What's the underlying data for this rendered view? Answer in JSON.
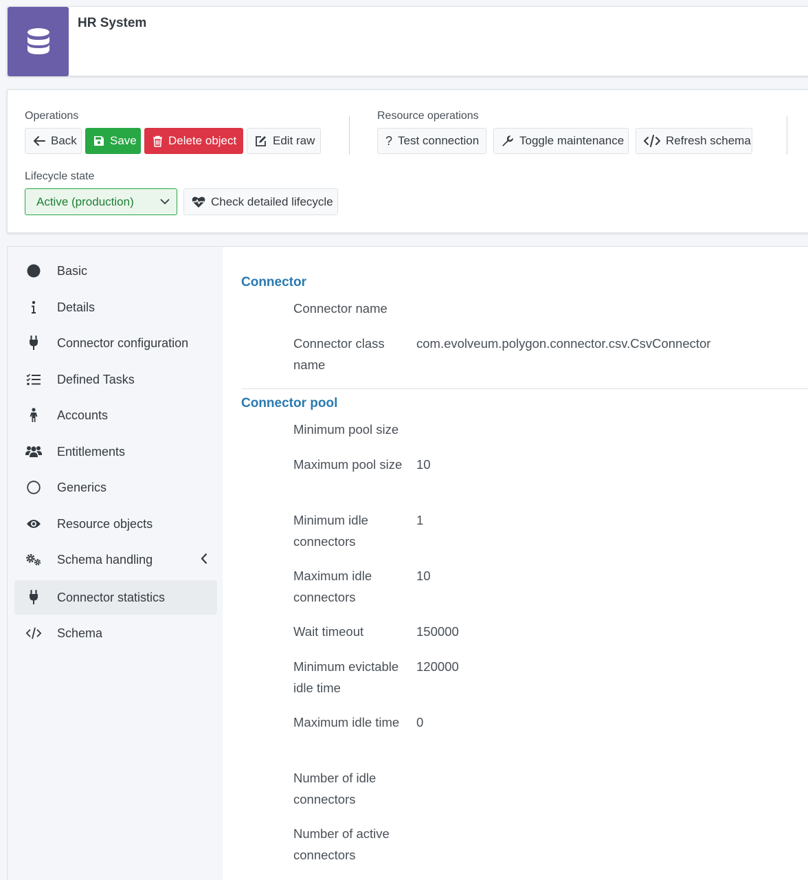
{
  "header": {
    "title": "HR System",
    "icon": "database-icon",
    "accent": "#6a5ea8"
  },
  "operations": {
    "label": "Operations",
    "back": "Back",
    "save": "Save",
    "delete": "Delete object",
    "edit_raw": "Edit raw"
  },
  "resource_operations": {
    "label": "Resource operations",
    "test_connection": "Test connection",
    "toggle_maintenance": "Toggle maintenance",
    "refresh_schema": "Refresh schema"
  },
  "lifecycle": {
    "label": "Lifecycle state",
    "selected": "Active (production)",
    "check_detailed": "Check detailed lifecycle"
  },
  "sidebar": {
    "items": [
      {
        "label": "Basic",
        "icon": "circle-filled-icon"
      },
      {
        "label": "Details",
        "icon": "info-icon"
      },
      {
        "label": "Connector configuration",
        "icon": "plug-icon"
      },
      {
        "label": "Defined Tasks",
        "icon": "tasks-list-icon"
      },
      {
        "label": "Accounts",
        "icon": "person-icon"
      },
      {
        "label": "Entitlements",
        "icon": "users-icon"
      },
      {
        "label": "Generics",
        "icon": "circle-outline-icon"
      },
      {
        "label": "Resource objects",
        "icon": "eye-icon"
      },
      {
        "label": "Schema handling",
        "icon": "gears-icon"
      },
      {
        "label": "Connector statistics",
        "icon": "plug-icon"
      },
      {
        "label": "Schema",
        "icon": "code-icon"
      }
    ],
    "active_index": 9
  },
  "connector": {
    "title": "Connector",
    "name_label": "Connector name",
    "name_value": "",
    "class_label": "Connector class name",
    "class_value": "com.evolveum.polygon.connector.csv.CsvConnector"
  },
  "pool": {
    "title": "Connector pool",
    "min_pool_label": "Minimum pool size",
    "min_pool_value": "",
    "max_pool_label": "Maximum pool size",
    "max_pool_value": "10",
    "min_idle_label": "Minimum idle connectors",
    "min_idle_value": "1",
    "max_idle_label": "Maximum idle connectors",
    "max_idle_value": "10",
    "wait_label": "Wait timeout",
    "wait_value": "150000",
    "min_evict_label": "Minimum evictable idle time",
    "min_evict_value": "120000",
    "max_idle_time_label": "Maximum idle time",
    "max_idle_time_value": "0",
    "num_idle_label": "Number of idle connectors",
    "num_idle_value": "",
    "num_active_label": "Number of active connectors",
    "num_active_value": ""
  }
}
